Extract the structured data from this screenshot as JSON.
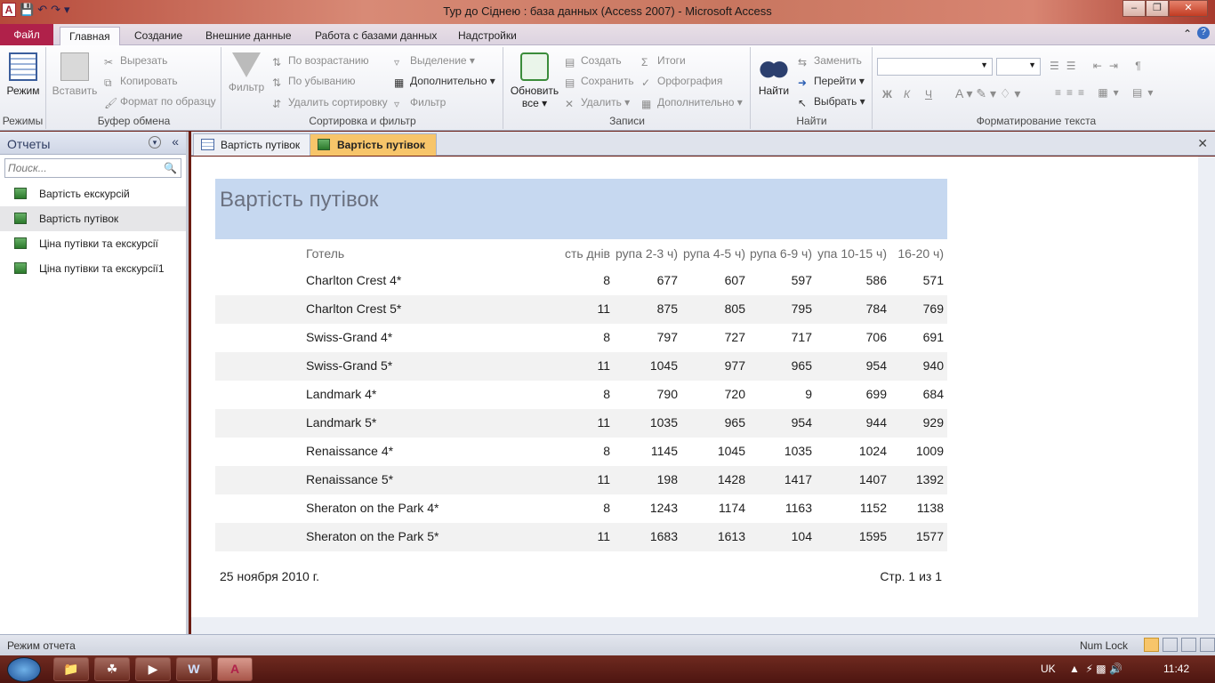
{
  "window": {
    "title": "Тур до Сіднею : база данных (Access 2007)  -  Microsoft Access",
    "app_icon": "A"
  },
  "ribbon_tabs": {
    "file": "Файл",
    "tabs": [
      "Главная",
      "Создание",
      "Внешние данные",
      "Работа с базами данных",
      "Надстройки"
    ]
  },
  "ribbon": {
    "views": {
      "mode": "Режим",
      "label": "Режимы"
    },
    "clipboard": {
      "paste": "Вставить",
      "cut": "Вырезать",
      "copy": "Копировать",
      "format_painter": "Формат по образцу",
      "label": "Буфер обмена"
    },
    "sort": {
      "filter": "Фильтр",
      "ascending": "По возрастанию",
      "descending": "По убыванию",
      "remove_sort": "Удалить сортировку",
      "selection": "Выделение",
      "advanced": "Дополнительно",
      "toggle_filter": "Фильтр",
      "label": "Сортировка и фильтр"
    },
    "records": {
      "refresh_all": "Обновить",
      "refresh_all_2": "все",
      "new": "Создать",
      "save": "Сохранить",
      "delete": "Удалить",
      "totals": "Итоги",
      "spelling": "Орфография",
      "more": "Дополнительно",
      "label": "Записи"
    },
    "find": {
      "find": "Найти",
      "replace": "Заменить",
      "goto": "Перейти",
      "select": "Выбрать",
      "label": "Найти"
    },
    "text": {
      "bold": "Ж",
      "italic": "К",
      "underline": "Ч",
      "label": "Форматирование текста"
    }
  },
  "nav_pane": {
    "title": "Отчеты",
    "search_placeholder": "Поиск...",
    "items": [
      {
        "label": "Вартість екскурсій"
      },
      {
        "label": "Вартість путівок"
      },
      {
        "label": "Ціна путівки та екскурсії"
      },
      {
        "label": "Ціна путівки та екскурсії1"
      }
    ]
  },
  "doc_tabs": [
    "Вартість путівок",
    "Вартість путівок"
  ],
  "report": {
    "title": "Вартість путівок",
    "headers": [
      "Готель",
      "сть днів",
      "рупа 2-3 ч)",
      "рупа 4-5 ч)",
      "рупа 6-9 ч)",
      "упа 10-15 ч)",
      "16-20 ч)"
    ],
    "rows": [
      [
        "Charlton Crest 4*",
        "8",
        "677",
        "607",
        "597",
        "586",
        "571"
      ],
      [
        "Charlton Crest 5*",
        "11",
        "875",
        "805",
        "795",
        "784",
        "769"
      ],
      [
        "Swiss-Grand 4*",
        "8",
        "797",
        "727",
        "717",
        "706",
        "691"
      ],
      [
        "Swiss-Grand 5*",
        "11",
        "1045",
        "977",
        "965",
        "954",
        "940"
      ],
      [
        "Landmark 4*",
        "8",
        "790",
        "720",
        "9",
        "699",
        "684"
      ],
      [
        "Landmark 5*",
        "11",
        "1035",
        "965",
        "954",
        "944",
        "929"
      ],
      [
        "Renaissance 4*",
        "8",
        "1145",
        "1045",
        "1035",
        "1024",
        "1009"
      ],
      [
        "Renaissance 5*",
        "11",
        "198",
        "1428",
        "1417",
        "1407",
        "1392"
      ],
      [
        "Sheraton on the Park 4*",
        "8",
        "1243",
        "1174",
        "1163",
        "1152",
        "1138"
      ],
      [
        "Sheraton on the Park 5*",
        "11",
        "1683",
        "1613",
        "104",
        "1595",
        "1577"
      ]
    ],
    "date": "25 ноября 2010 г.",
    "page": "Стр. 1 из 1"
  },
  "status": {
    "mode": "Режим отчета",
    "numlock": "Num Lock"
  },
  "taskbar": {
    "lang": "UK",
    "time": "11:42"
  },
  "colors": {
    "title_band": "#c6d8f0",
    "active_tab": "#f7c56a",
    "file_tab": "#b0214a"
  }
}
